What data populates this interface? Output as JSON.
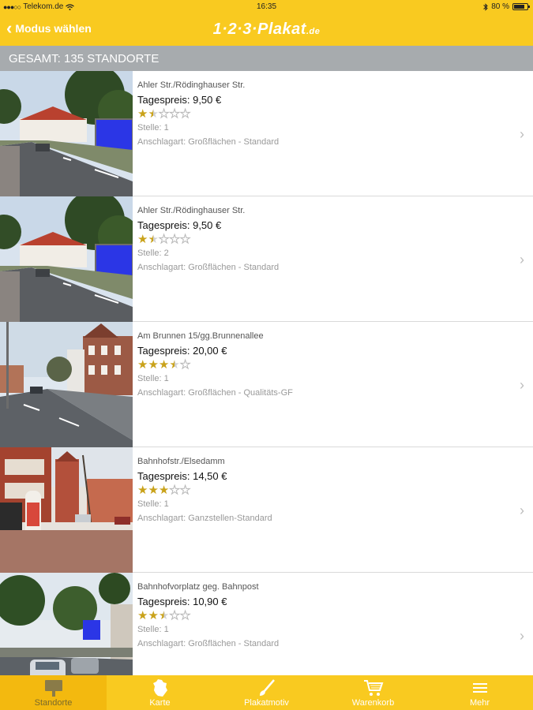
{
  "status_bar": {
    "carrier": "Telekom.de",
    "time": "16:35",
    "battery": "80 %",
    "battery_level": 0.8
  },
  "nav": {
    "back_label": "Modus wählen",
    "logo_main": "1·2·3·Plakat",
    "logo_suffix": ".de"
  },
  "section": {
    "header": "GESAMT: 135 STANDORTE"
  },
  "items": [
    {
      "street": "Ahler Str./Rödinghauser Str.",
      "price": "Tagespreis: 9,50 €",
      "rating": 1.5,
      "stelle": "Stelle: 1",
      "anschlag": "Anschlagart: Großflächen - Standard"
    },
    {
      "street": "Ahler Str./Rödinghauser Str.",
      "price": "Tagespreis: 9,50 €",
      "rating": 1.5,
      "stelle": "Stelle: 2",
      "anschlag": "Anschlagart: Großflächen - Standard"
    },
    {
      "street": "Am Brunnen 15/gg.Brunnenallee",
      "price": "Tagespreis: 20,00 €",
      "rating": 3.5,
      "stelle": "Stelle: 1",
      "anschlag": "Anschlagart: Großflächen - Qualitäts-GF"
    },
    {
      "street": "Bahnhofstr./Elsedamm",
      "price": "Tagespreis: 14,50 €",
      "rating": 3,
      "stelle": "Stelle: 1",
      "anschlag": "Anschlagart: Ganzstellen-Standard"
    },
    {
      "street": "Bahnhofvorplatz geg. Bahnpost",
      "price": "Tagespreis: 10,90 €",
      "rating": 2.5,
      "stelle": "Stelle: 1",
      "anschlag": "Anschlagart: Großflächen - Standard"
    }
  ],
  "tabs": [
    {
      "label": "Standorte",
      "icon": "billboard-icon",
      "active": true
    },
    {
      "label": "Karte",
      "icon": "germany-map-icon",
      "active": false
    },
    {
      "label": "Plakatmotiv",
      "icon": "brush-icon",
      "active": false
    },
    {
      "label": "Warenkorb",
      "icon": "cart-icon",
      "active": false
    },
    {
      "label": "Mehr",
      "icon": "more-list-icon",
      "active": false
    }
  ],
  "colors": {
    "accent_yellow": "#f9ca20",
    "section_gray": "#a7abae",
    "star_gold": "#c9a21a"
  }
}
